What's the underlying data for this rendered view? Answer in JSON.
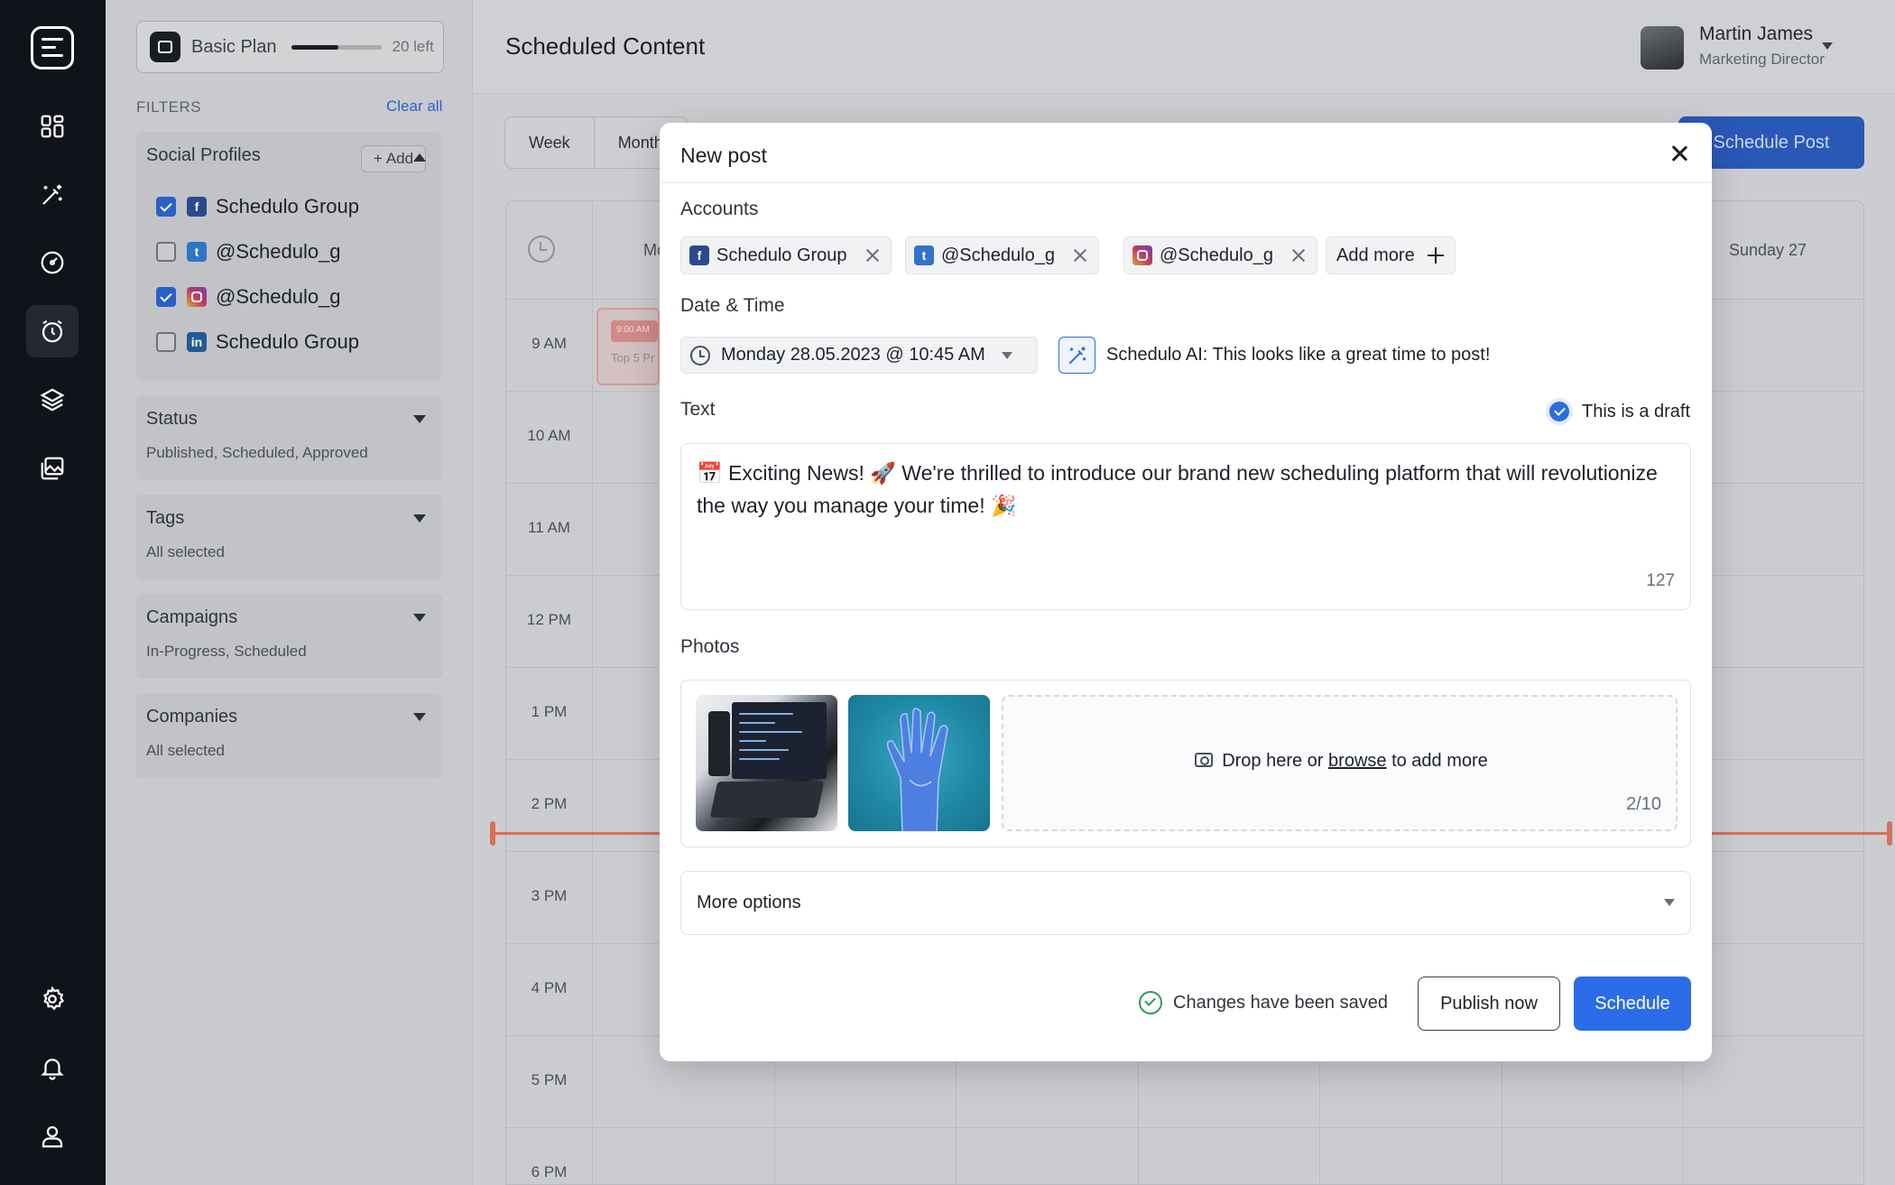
{
  "rail": {
    "icons": [
      "menu-logo-icon",
      "dashboard-icon",
      "magic-wand-icon",
      "gauge-icon",
      "timer-icon",
      "layers-icon",
      "image-gallery-icon",
      "gear-icon",
      "bell-icon",
      "user-icon"
    ],
    "active": "timer-icon"
  },
  "plan": {
    "name": "Basic Plan",
    "remaining": "20 left",
    "usage_fraction": 0.52
  },
  "filters": {
    "heading": "FILTERS",
    "clear_all": "Clear all",
    "social_profiles": {
      "title": "Social Profiles",
      "add_label": "Add",
      "items": [
        {
          "network": "facebook",
          "label": "Schedulo Group",
          "checked": true
        },
        {
          "network": "twitter",
          "label": "@Schedulo_g",
          "checked": false
        },
        {
          "network": "instagram",
          "label": "@Schedulo_g",
          "checked": true
        },
        {
          "network": "linkedin",
          "label": "Schedulo Group",
          "checked": false
        }
      ]
    },
    "status": {
      "title": "Status",
      "value": "Published, Scheduled, Approved"
    },
    "tags": {
      "title": "Tags",
      "value": "All selected"
    },
    "campaigns": {
      "title": "Campaigns",
      "value": "In-Progress, Scheduled"
    },
    "companies": {
      "title": "Companies",
      "value": "All selected"
    }
  },
  "header": {
    "title": "Scheduled Content",
    "user_name": "Martin James",
    "user_role": "Marketing Director"
  },
  "calendar": {
    "view_tabs": [
      "Week",
      "Month"
    ],
    "schedule_post_label": "Schedule Post",
    "day_partial": "Mo",
    "sunday_label": "Sunday 27",
    "times": [
      "9 AM",
      "10 AM",
      "11 AM",
      "12 PM",
      "1 PM",
      "2 PM",
      "3 PM",
      "4 PM",
      "5 PM",
      "6 PM"
    ],
    "event": {
      "time": "9:00 AM",
      "title": "Top 5 Pr"
    }
  },
  "modal": {
    "title": "New post",
    "accounts_label": "Accounts",
    "accounts": [
      {
        "network": "facebook",
        "label": "Schedulo Group"
      },
      {
        "network": "twitter",
        "label": "@Schedulo_g"
      },
      {
        "network": "instagram",
        "label": "@Schedulo_g"
      }
    ],
    "add_more_label": "Add more",
    "date_time_label": "Date & Time",
    "date_time_value": "Monday 28.05.2023 @ 10:45 AM",
    "ai_hint": "Schedulo AI: This looks like a great time to post!",
    "text_label": "Text",
    "draft_label": "This is a draft",
    "draft_checked": true,
    "post_text": "📅 Exciting News! 🚀 We're thrilled to introduce our brand new scheduling platform that will revolutionize the way you manage your time! 🎉",
    "char_count": "127",
    "photos_label": "Photos",
    "drop_before": "Drop here or ",
    "drop_link": "browse",
    "drop_after": " to add more",
    "photo_count": "2/10",
    "more_options_label": "More options",
    "saved_status": "Changes have been saved",
    "publish_now_label": "Publish now",
    "schedule_label": "Schedule"
  },
  "colors": {
    "accent": "#2b6ce8",
    "rail_bg": "#10131a",
    "now_line": "#d86f59",
    "saved_green": "#2e9c57"
  }
}
